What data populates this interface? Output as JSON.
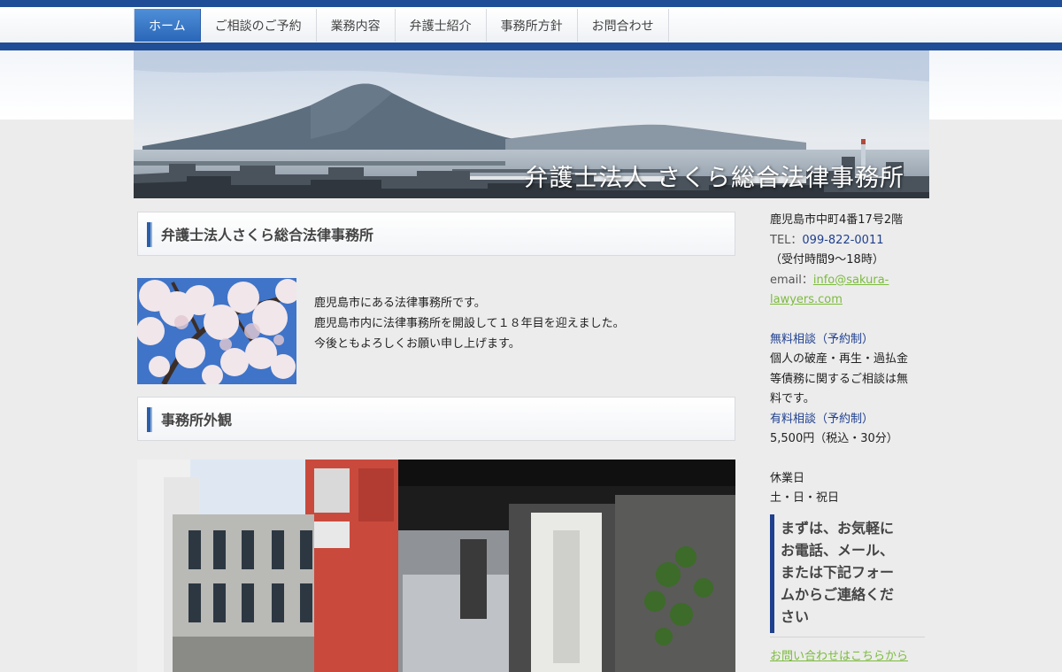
{
  "nav": {
    "items": [
      {
        "label": "ホーム",
        "active": true
      },
      {
        "label": "ご相談のご予約",
        "active": false
      },
      {
        "label": "業務内容",
        "active": false
      },
      {
        "label": "弁護士紹介",
        "active": false
      },
      {
        "label": "事務所方針",
        "active": false
      },
      {
        "label": "お問合わせ",
        "active": false
      }
    ]
  },
  "banner": {
    "title": "弁護士法人 さくら総合法律事務所"
  },
  "main": {
    "heading1": "弁護士法人さくら総合法律事務所",
    "intro_lines": [
      "鹿児島市にある法律事務所です。",
      "鹿児島市内に法律事務所を開設して１８年目を迎えました。",
      "今後ともよろしくお願い申し上げます。"
    ],
    "heading2": "事務所外観"
  },
  "sidebar": {
    "address": "鹿児島市中町4番17号2階",
    "tel_label": "TEL：",
    "tel_value": "099-822-0011",
    "hours": "（受付時間9～18時）",
    "email_label": "email：",
    "email_part1": "info@sakura-",
    "email_part2": "lawyers.com",
    "free_title": "無料相談（予約制）",
    "free_desc_lines": [
      "個人の破産・再生・過払金",
      "等債務に関するご相談は無",
      "料です。"
    ],
    "paid_title": "有料相談（予約制）",
    "paid_price": "5,500円（税込・30分）",
    "holiday_title": "休業日",
    "holiday_days": "土・日・祝日",
    "callout_lines": [
      "まずは、お気軽に",
      "お電話、メール、",
      "または下記フォー",
      "ムからご連絡くだ",
      "さい"
    ],
    "form_link": "お問い合わせはこちらから"
  },
  "colors": {
    "accent": "#1f4e96",
    "nav_active": "#2a66b8",
    "link": "#7cbb3c",
    "text_blue": "#1f3f8f"
  }
}
